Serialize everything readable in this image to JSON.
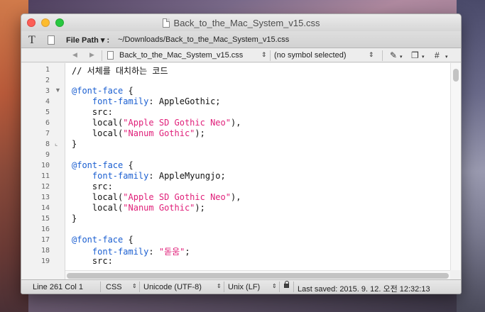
{
  "window": {
    "title": "Back_to_the_Mac_System_v15.css"
  },
  "toolbar": {
    "text_icon": "T",
    "file_path_label": "File Path ▾ :",
    "file_path_value": "~/Downloads/Back_to_the_Mac_System_v15.css"
  },
  "navbar": {
    "back_glyph": "◀",
    "forward_glyph": "▶",
    "file_name": "Back_to_the_Mac_System_v15.css",
    "updown_glyph": "⇕",
    "symbol": "(no symbol selected)",
    "pen_glyph": "✎",
    "docs_glyph": "❐",
    "hash_glyph": "#",
    "caret": "▾"
  },
  "editor": {
    "fold_open": "▼",
    "fold_close": "⌞",
    "lines": [
      {
        "n": "1",
        "indent": "",
        "segments": [
          {
            "t": "// 서체를 대치하는 코드",
            "c": ""
          }
        ]
      },
      {
        "n": "2",
        "indent": "",
        "segments": []
      },
      {
        "n": "3",
        "indent": "",
        "fold": "open",
        "segments": [
          {
            "t": "@font-face",
            "c": "c-at"
          },
          {
            "t": " {",
            "c": ""
          }
        ]
      },
      {
        "n": "4",
        "indent": "    ",
        "segments": [
          {
            "t": "font-family",
            "c": "c-prop"
          },
          {
            "t": ": AppleGothic;",
            "c": ""
          }
        ]
      },
      {
        "n": "5",
        "indent": "    ",
        "segments": [
          {
            "t": "src:",
            "c": ""
          }
        ]
      },
      {
        "n": "6",
        "indent": "    ",
        "segments": [
          {
            "t": "local(",
            "c": ""
          },
          {
            "t": "\"Apple SD Gothic Neo\"",
            "c": "c-str"
          },
          {
            "t": "),",
            "c": ""
          }
        ]
      },
      {
        "n": "7",
        "indent": "    ",
        "segments": [
          {
            "t": "local(",
            "c": ""
          },
          {
            "t": "\"Nanum Gothic\"",
            "c": "c-str"
          },
          {
            "t": ");",
            "c": ""
          }
        ]
      },
      {
        "n": "8",
        "indent": "",
        "fold": "close",
        "segments": [
          {
            "t": "}",
            "c": ""
          }
        ]
      },
      {
        "n": "9",
        "indent": "",
        "segments": []
      },
      {
        "n": "10",
        "indent": "",
        "segments": [
          {
            "t": "@font-face",
            "c": "c-at"
          },
          {
            "t": " {",
            "c": ""
          }
        ]
      },
      {
        "n": "11",
        "indent": "    ",
        "segments": [
          {
            "t": "font-family",
            "c": "c-prop"
          },
          {
            "t": ": AppleMyungjo;",
            "c": ""
          }
        ]
      },
      {
        "n": "12",
        "indent": "    ",
        "segments": [
          {
            "t": "src:",
            "c": ""
          }
        ]
      },
      {
        "n": "13",
        "indent": "    ",
        "segments": [
          {
            "t": "local(",
            "c": ""
          },
          {
            "t": "\"Apple SD Gothic Neo\"",
            "c": "c-str"
          },
          {
            "t": "),",
            "c": ""
          }
        ]
      },
      {
        "n": "14",
        "indent": "    ",
        "segments": [
          {
            "t": "local(",
            "c": ""
          },
          {
            "t": "\"Nanum Gothic\"",
            "c": "c-str"
          },
          {
            "t": ");",
            "c": ""
          }
        ]
      },
      {
        "n": "15",
        "indent": "",
        "segments": [
          {
            "t": "}",
            "c": ""
          }
        ]
      },
      {
        "n": "16",
        "indent": "",
        "segments": []
      },
      {
        "n": "17",
        "indent": "",
        "segments": [
          {
            "t": "@font-face",
            "c": "c-at"
          },
          {
            "t": " {",
            "c": ""
          }
        ]
      },
      {
        "n": "18",
        "indent": "    ",
        "segments": [
          {
            "t": "font-family",
            "c": "c-prop"
          },
          {
            "t": ": ",
            "c": ""
          },
          {
            "t": "\"돋움\"",
            "c": "c-str"
          },
          {
            "t": ";",
            "c": ""
          }
        ]
      },
      {
        "n": "19",
        "indent": "    ",
        "segments": [
          {
            "t": "src:",
            "c": ""
          }
        ]
      }
    ]
  },
  "statusbar": {
    "position": "Line 261 Col 1",
    "language": "CSS",
    "encoding": "Unicode (UTF-8)",
    "line_endings": "Unix (LF)",
    "last_saved": "Last saved: 2015. 9. 12. 오전 12:32:13",
    "updown_glyph": "⇕"
  },
  "colors": {
    "property": "#1b5fd1",
    "string": "#e0207a",
    "close": "#fc5f57",
    "minimize": "#fdbc2e",
    "zoom": "#28c840"
  }
}
